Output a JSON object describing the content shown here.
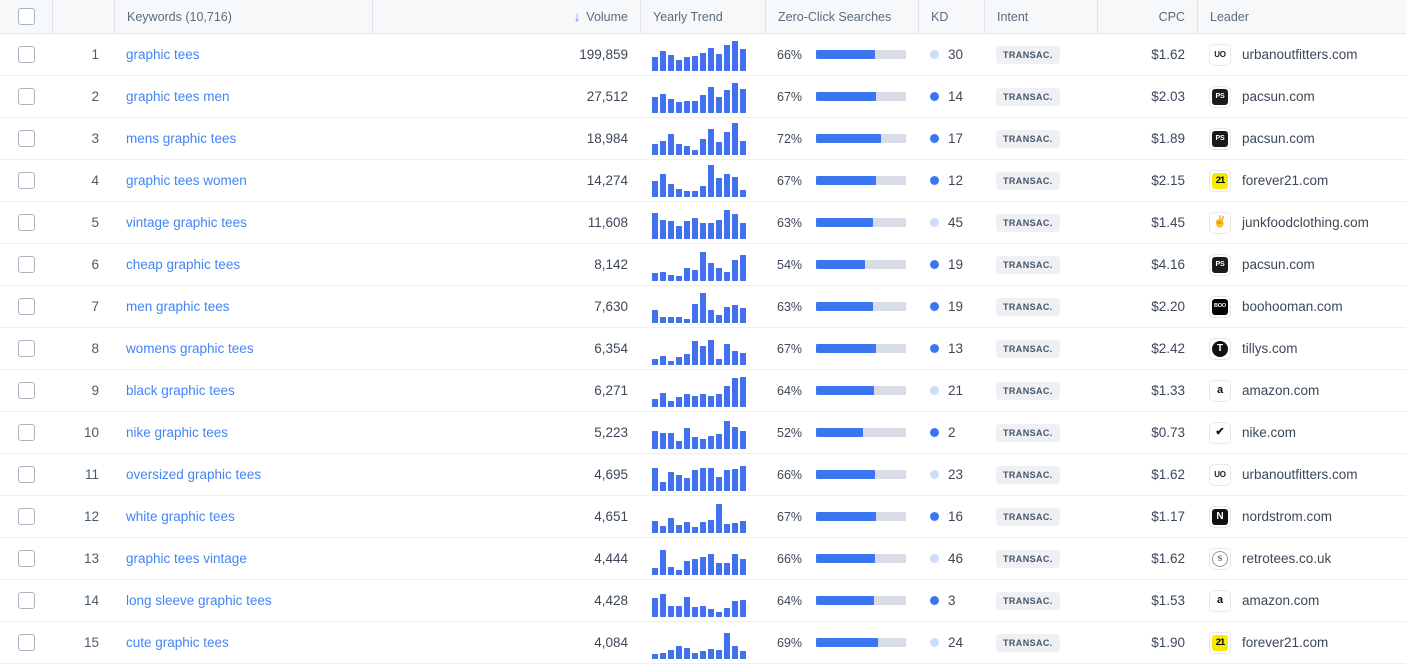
{
  "table": {
    "columns": [
      {
        "key": "select",
        "label": "",
        "icon": "checkbox-icon"
      },
      {
        "key": "rank",
        "label": ""
      },
      {
        "key": "keyword",
        "label": "Keywords (10,716)"
      },
      {
        "key": "volume",
        "label": "Volume",
        "sorted": "desc",
        "sort_icon": "arrow-down-icon"
      },
      {
        "key": "trend",
        "label": "Yearly Trend"
      },
      {
        "key": "zeroclick",
        "label": "Zero-Click Searches"
      },
      {
        "key": "kd",
        "label": "KD"
      },
      {
        "key": "intent",
        "label": "Intent"
      },
      {
        "key": "cpc",
        "label": "CPC"
      },
      {
        "key": "leader",
        "label": "Leader"
      }
    ],
    "keyword_count_label": "Keywords (10,716)",
    "rows": [
      {
        "rank": "1",
        "keyword": "graphic tees",
        "volume": "199,859",
        "trend": [
          38,
          55,
          42,
          30,
          38,
          40,
          48,
          62,
          45,
          72,
          82,
          60
        ],
        "zero_click_pct": "66%",
        "zero_click_value": 66,
        "kd": "30",
        "kd_level": "hard",
        "intent": "TRANSAC.",
        "cpc": "$1.62",
        "leader_domain": "urbanoutfitters.com",
        "leader_icon": "urbanoutfitters-favicon",
        "icon_class": "uo",
        "icon_text": "UO"
      },
      {
        "rank": "2",
        "keyword": "graphic tees men",
        "volume": "27,512",
        "trend": [
          44,
          52,
          38,
          28,
          32,
          32,
          48,
          72,
          42,
          62,
          82,
          65
        ],
        "zero_click_pct": "67%",
        "zero_click_value": 67,
        "kd": "14",
        "kd_level": "easy",
        "intent": "TRANSAC.",
        "cpc": "$2.03",
        "leader_domain": "pacsun.com",
        "leader_icon": "pacsun-favicon",
        "icon_class": "ps",
        "icon_text": "PS"
      },
      {
        "rank": "3",
        "keyword": "mens graphic tees",
        "volume": "18,984",
        "trend": [
          30,
          38,
          58,
          28,
          24,
          12,
          42,
          72,
          34,
          62,
          88,
          38
        ],
        "zero_click_pct": "72%",
        "zero_click_value": 72,
        "kd": "17",
        "kd_level": "easy",
        "intent": "TRANSAC.",
        "cpc": "$1.89",
        "leader_domain": "pacsun.com",
        "leader_icon": "pacsun-favicon",
        "icon_class": "ps",
        "icon_text": "PS"
      },
      {
        "rank": "4",
        "keyword": "graphic tees women",
        "volume": "14,274",
        "trend": [
          42,
          62,
          34,
          20,
          16,
          16,
          30,
          88,
          52,
          62,
          55,
          18
        ],
        "zero_click_pct": "67%",
        "zero_click_value": 67,
        "kd": "12",
        "kd_level": "easy",
        "intent": "TRANSAC.",
        "cpc": "$2.15",
        "leader_domain": "forever21.com",
        "leader_icon": "forever21-favicon",
        "icon_class": "f21",
        "icon_text": "21"
      },
      {
        "rank": "5",
        "keyword": "vintage graphic tees",
        "volume": "11,608",
        "trend": [
          72,
          52,
          50,
          34,
          48,
          58,
          44,
          42,
          52,
          78,
          68,
          42
        ],
        "zero_click_pct": "63%",
        "zero_click_value": 63,
        "kd": "45",
        "kd_level": "hard",
        "intent": "TRANSAC.",
        "cpc": "$1.45",
        "leader_domain": "junkfoodclothing.com",
        "leader_icon": "junkfood-favicon",
        "icon_class": "jf",
        "icon_text": "✌"
      },
      {
        "rank": "6",
        "keyword": "cheap graphic tees",
        "volume": "8,142",
        "trend": [
          22,
          24,
          14,
          12,
          36,
          28,
          80,
          48,
          34,
          24,
          56,
          70
        ],
        "zero_click_pct": "54%",
        "zero_click_value": 54,
        "kd": "19",
        "kd_level": "easy",
        "intent": "TRANSAC.",
        "cpc": "$4.16",
        "leader_domain": "pacsun.com",
        "leader_icon": "pacsun-favicon",
        "icon_class": "ps",
        "icon_text": "PS"
      },
      {
        "rank": "7",
        "keyword": "men graphic tees",
        "volume": "7,630",
        "trend": [
          36,
          14,
          14,
          14,
          10,
          52,
          82,
          34,
          22,
          44,
          48,
          40
        ],
        "zero_click_pct": "63%",
        "zero_click_value": 63,
        "kd": "19",
        "kd_level": "easy",
        "intent": "TRANSAC.",
        "cpc": "$2.20",
        "leader_domain": "boohooman.com",
        "leader_icon": "boohooman-favicon",
        "icon_class": "bh",
        "icon_text": "BOO"
      },
      {
        "rank": "8",
        "keyword": "womens graphic tees",
        "volume": "6,354",
        "trend": [
          14,
          24,
          10,
          22,
          28,
          66,
          52,
          68,
          16,
          58,
          38,
          32
        ],
        "zero_click_pct": "67%",
        "zero_click_value": 67,
        "kd": "13",
        "kd_level": "easy",
        "intent": "TRANSAC.",
        "cpc": "$2.42",
        "leader_domain": "tillys.com",
        "leader_icon": "tillys-favicon",
        "icon_class": "ti",
        "icon_text": "T"
      },
      {
        "rank": "9",
        "keyword": "black graphic tees",
        "volume": "6,271",
        "trend": [
          22,
          38,
          14,
          26,
          36,
          28,
          36,
          30,
          34,
          58,
          80,
          82
        ],
        "zero_click_pct": "64%",
        "zero_click_value": 64,
        "kd": "21",
        "kd_level": "hard",
        "intent": "TRANSAC.",
        "cpc": "$1.33",
        "leader_domain": "amazon.com",
        "leader_icon": "amazon-favicon",
        "icon_class": "am",
        "icon_text": "a"
      },
      {
        "rank": "10",
        "keyword": "nike graphic tees",
        "volume": "5,223",
        "trend": [
          48,
          44,
          44,
          22,
          56,
          32,
          26,
          34,
          40,
          76,
          60,
          48
        ],
        "zero_click_pct": "52%",
        "zero_click_value": 52,
        "kd": "2",
        "kd_level": "easy",
        "intent": "TRANSAC.",
        "cpc": "$0.73",
        "leader_domain": "nike.com",
        "leader_icon": "nike-favicon",
        "icon_class": "nk",
        "icon_text": "✔"
      },
      {
        "rank": "11",
        "keyword": "oversized graphic tees",
        "volume": "4,695",
        "trend": [
          62,
          24,
          52,
          42,
          34,
          58,
          62,
          62,
          38,
          58,
          60,
          68
        ],
        "zero_click_pct": "66%",
        "zero_click_value": 66,
        "kd": "23",
        "kd_level": "hard",
        "intent": "TRANSAC.",
        "cpc": "$1.62",
        "leader_domain": "urbanoutfitters.com",
        "leader_icon": "urbanoutfitters-favicon",
        "icon_class": "uo",
        "icon_text": "UO"
      },
      {
        "rank": "12",
        "keyword": "white graphic tees",
        "volume": "4,651",
        "trend": [
          32,
          18,
          40,
          22,
          28,
          14,
          28,
          34,
          78,
          24,
          26,
          32
        ],
        "zero_click_pct": "67%",
        "zero_click_value": 67,
        "kd": "16",
        "kd_level": "easy",
        "intent": "TRANSAC.",
        "cpc": "$1.17",
        "leader_domain": "nordstrom.com",
        "leader_icon": "nordstrom-favicon",
        "icon_class": "nd",
        "icon_text": "N"
      },
      {
        "rank": "13",
        "keyword": "graphic tees vintage",
        "volume": "4,444",
        "trend": [
          18,
          68,
          22,
          12,
          38,
          44,
          48,
          58,
          32,
          32,
          58,
          42
        ],
        "zero_click_pct": "66%",
        "zero_click_value": 66,
        "kd": "46",
        "kd_level": "hard",
        "intent": "TRANSAC.",
        "cpc": "$1.62",
        "leader_domain": "retrotees.co.uk",
        "leader_icon": "retrotees-favicon",
        "icon_class": "rt",
        "icon_text": "S"
      },
      {
        "rank": "14",
        "keyword": "long sleeve graphic tees",
        "volume": "4,428",
        "trend": [
          52,
          62,
          30,
          30,
          54,
          26,
          30,
          20,
          12,
          24,
          42,
          46
        ],
        "zero_click_pct": "64%",
        "zero_click_value": 64,
        "kd": "3",
        "kd_level": "easy",
        "intent": "TRANSAC.",
        "cpc": "$1.53",
        "leader_domain": "amazon.com",
        "leader_icon": "amazon-favicon",
        "icon_class": "am",
        "icon_text": "a"
      },
      {
        "rank": "15",
        "keyword": "cute graphic tees",
        "volume": "4,084",
        "trend": [
          12,
          14,
          24,
          34,
          30,
          14,
          22,
          26,
          24,
          70,
          34,
          20
        ],
        "zero_click_pct": "69%",
        "zero_click_value": 69,
        "kd": "24",
        "kd_level": "hard",
        "intent": "TRANSAC.",
        "cpc": "$1.90",
        "leader_domain": "forever21.com",
        "leader_icon": "forever21-favicon",
        "icon_class": "f21",
        "icon_text": "21"
      }
    ]
  },
  "colors": {
    "accent_blue": "#4285f4",
    "bar_blue": "#4271ef",
    "progress_blue": "#3b76f0",
    "progress_track": "#d8dce4",
    "kd_hard": "#ccdcfb",
    "kd_easy": "#3b76f0",
    "header_bg": "#f7f8f9",
    "text": "#3c4858"
  }
}
